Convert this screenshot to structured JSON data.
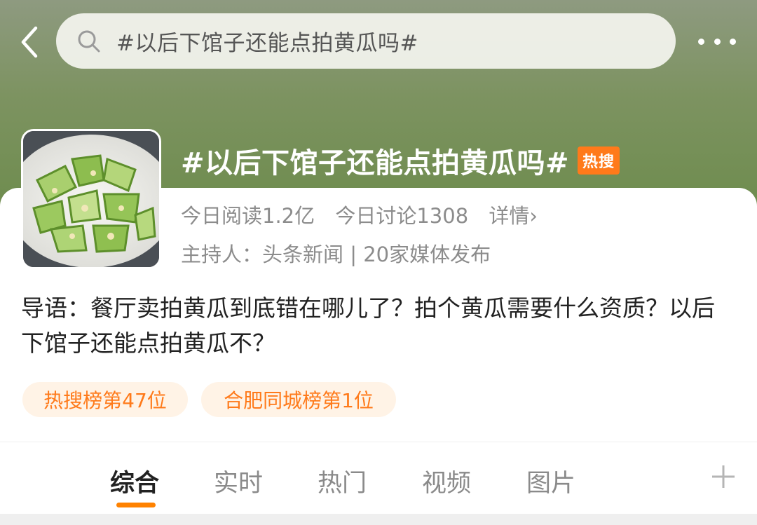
{
  "header": {
    "search_query": "#以后下馆子还能点拍黄瓜吗#",
    "back_icon": "chevron-left-icon",
    "search_icon": "search-icon",
    "more_icon": "more-dots-icon"
  },
  "topic": {
    "title": "#以后下馆子还能点拍黄瓜吗#",
    "badge": "热搜",
    "reads": "今日阅读1.2亿",
    "discussions": "今日讨论1308",
    "detail_link": "详情›",
    "host": "主持人：头条新闻 | 20家媒体发布",
    "guide": "导语：餐厅卖拍黄瓜到底错在哪儿了？拍个黄瓜需要什么资质？以后下馆子还能点拍黄瓜不？"
  },
  "rank_pills": [
    "热搜榜第47位",
    "合肥同城榜第1位"
  ],
  "tabs": [
    {
      "label": "综合",
      "active": true
    },
    {
      "label": "实时",
      "active": false
    },
    {
      "label": "热门",
      "active": false
    },
    {
      "label": "视频",
      "active": false
    },
    {
      "label": "图片",
      "active": false
    }
  ],
  "colors": {
    "accent": "#ff8200",
    "badge": "#ff7a1a",
    "pill_bg": "#fff3e6"
  }
}
